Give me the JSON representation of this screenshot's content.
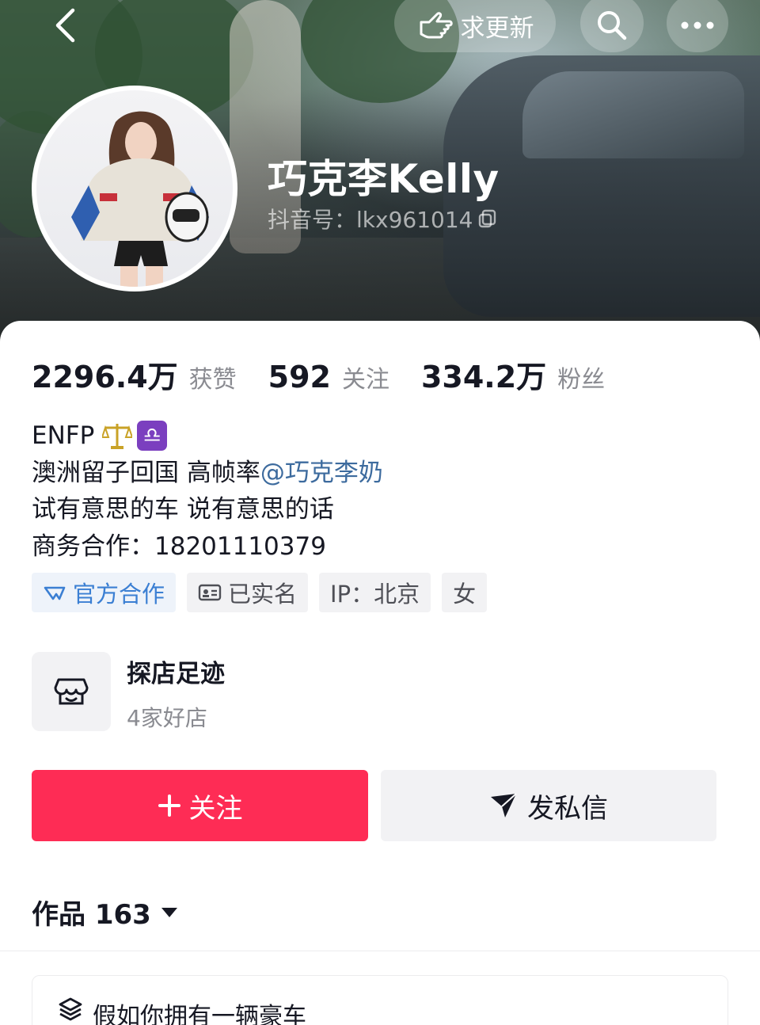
{
  "header": {
    "update_label": "求更新"
  },
  "profile": {
    "name": "巧克李Kelly",
    "douyin_id": "抖音号：lkx961014"
  },
  "stats": [
    {
      "value": "2296.4万",
      "label": "获赞"
    },
    {
      "value": "592",
      "label": "关注"
    },
    {
      "value": "334.2万",
      "label": "粉丝"
    }
  ],
  "bio": {
    "line1": "ENFP",
    "line2_text": "澳洲留子回国 高帧率",
    "line2_mention": "@巧克李奶",
    "line3": "试有意思的车 说有意思的话",
    "line4": "商务合作：18201110379"
  },
  "tags": {
    "official": "官方合作",
    "verified": "已实名",
    "ip": "IP：北京",
    "gender": "女"
  },
  "shop": {
    "title": "探店足迹",
    "subtitle": "4家好店"
  },
  "actions": {
    "follow": "关注",
    "message": "发私信"
  },
  "works": {
    "label": "作品 163"
  },
  "collection": {
    "title": "假如你拥有一辆豪车"
  },
  "colors": {
    "primary": "#fe2c55",
    "official_tag": "#3b7fd3",
    "mention": "#3d6b9e",
    "zodiac": "#7b3fbf"
  }
}
